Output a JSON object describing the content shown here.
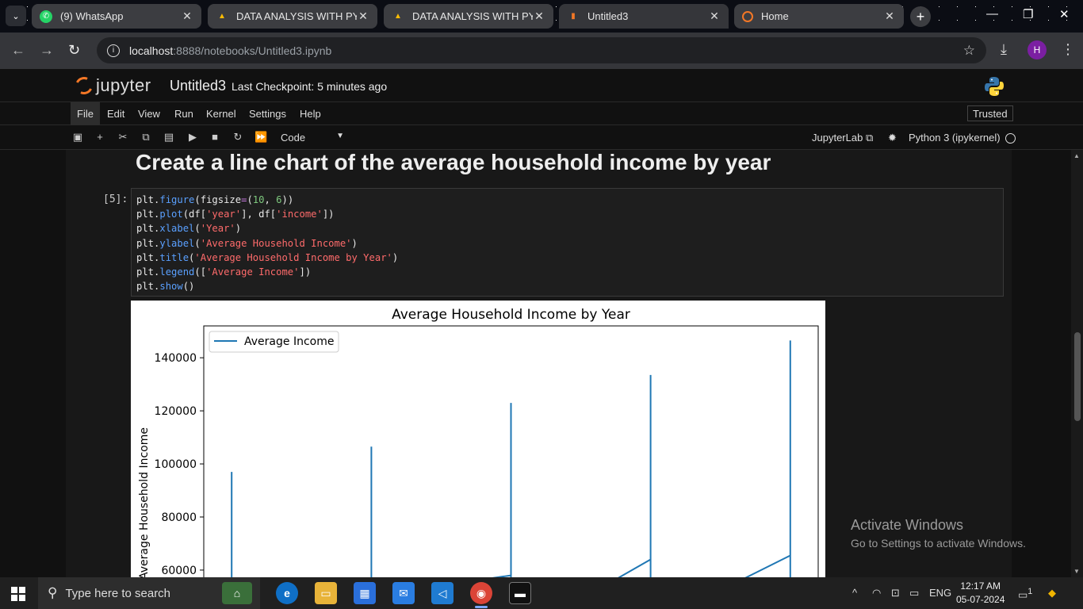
{
  "browser": {
    "tabs": [
      {
        "label": "(9) WhatsApp",
        "icon": "whatsapp-icon",
        "color": "#25d366"
      },
      {
        "label": "DATA ANALYSIS WITH PYTHO",
        "icon": "drive-icon",
        "color": "#fbbc04"
      },
      {
        "label": "DATA ANALYSIS WITH PYTHO",
        "icon": "drive-icon",
        "color": "#fbbc04"
      },
      {
        "label": "Untitled3",
        "icon": "notebook-icon",
        "color": "#f37726"
      },
      {
        "label": "Home",
        "icon": "jupyter-icon",
        "color": "#f37726"
      }
    ],
    "url_host": "localhost",
    "url_rest": ":8888/notebooks/Untitled3.ipynb",
    "avatar_letter": "H"
  },
  "jupyter": {
    "logo_text": "jupyter",
    "notebook_name": "Untitled3",
    "checkpoint": "Last Checkpoint: 5 minutes ago",
    "menu": [
      "File",
      "Edit",
      "View",
      "Run",
      "Kernel",
      "Settings",
      "Help"
    ],
    "trusted": "Trusted",
    "cell_type": "Code",
    "jupyterlab_link": "JupyterLab",
    "kernel": "Python 3 (ipykernel)"
  },
  "cells": {
    "heading": "Create a line chart of the average household income by year",
    "prompt": "[5]:"
  },
  "chart_data": {
    "type": "line",
    "title": "Average Household Income by Year",
    "xlabel": "",
    "ylabel": "Average Household Income",
    "legend": [
      "Average Income"
    ],
    "legend_position": "top-left",
    "line_color": "#1f77b4",
    "yticks": [
      "60000",
      "80000",
      "100000",
      "120000",
      "140000"
    ],
    "ylim_visible": [
      54000,
      152000
    ],
    "series": [
      {
        "name": "Average Income",
        "segments": [
          [
            [
              1,
              55000
            ],
            [
              1,
              97000
            ],
            [
              1,
              78000
            ],
            [
              1,
              55000
            ]
          ],
          [
            [
              2,
              55000
            ],
            [
              2,
              106500
            ],
            [
              2,
              86000
            ],
            [
              2,
              55000
            ]
          ],
          [
            [
              2.6,
              55000
            ],
            [
              3,
              58000
            ],
            [
              3,
              123000
            ],
            [
              3,
              55000
            ]
          ],
          [
            [
              3.7,
              55000
            ],
            [
              4,
              64000
            ],
            [
              4,
              133500
            ],
            [
              4,
              55000
            ]
          ],
          [
            [
              4.6,
              55000
            ],
            [
              5,
              65500
            ],
            [
              5,
              146500
            ],
            [
              5,
              104000
            ],
            [
              5,
              55000
            ]
          ]
        ]
      }
    ]
  },
  "overlay": {
    "activate_title": "Activate Windows",
    "activate_sub": "Go to Settings to activate Windows."
  },
  "taskbar": {
    "search_placeholder": "Type here to search",
    "lang": "ENG",
    "time": "12:17 AM",
    "date": "05-07-2024",
    "notif_count": "1"
  }
}
